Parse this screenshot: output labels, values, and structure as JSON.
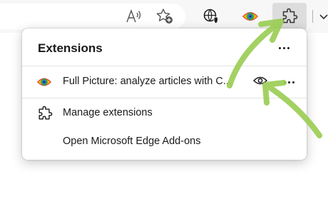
{
  "toolbar": {
    "buttons": [
      {
        "icon": "read-aloud-icon"
      },
      {
        "icon": "add-favorite-icon"
      },
      {
        "icon": "tracking-prevention-icon"
      },
      {
        "icon": "full-picture-extension-icon"
      },
      {
        "icon": "extensions-puzzle-icon"
      },
      {
        "icon": "chevron-down-icon"
      }
    ]
  },
  "panel": {
    "title": "Extensions",
    "more_icon": "more-options-icon",
    "extension": {
      "name": "Full Picture: analyze articles with C...",
      "icon": "full-picture-eye-icon",
      "pin_icon": "visibility-eye-icon",
      "more_icon": "more-options-icon"
    },
    "menu": [
      {
        "label": "Manage extensions",
        "icon": "puzzle-icon"
      },
      {
        "label": "Open Microsoft Edge Add-ons",
        "icon": ""
      }
    ]
  },
  "annotations": {
    "arrow_color": "#9acd52",
    "count": 2
  }
}
